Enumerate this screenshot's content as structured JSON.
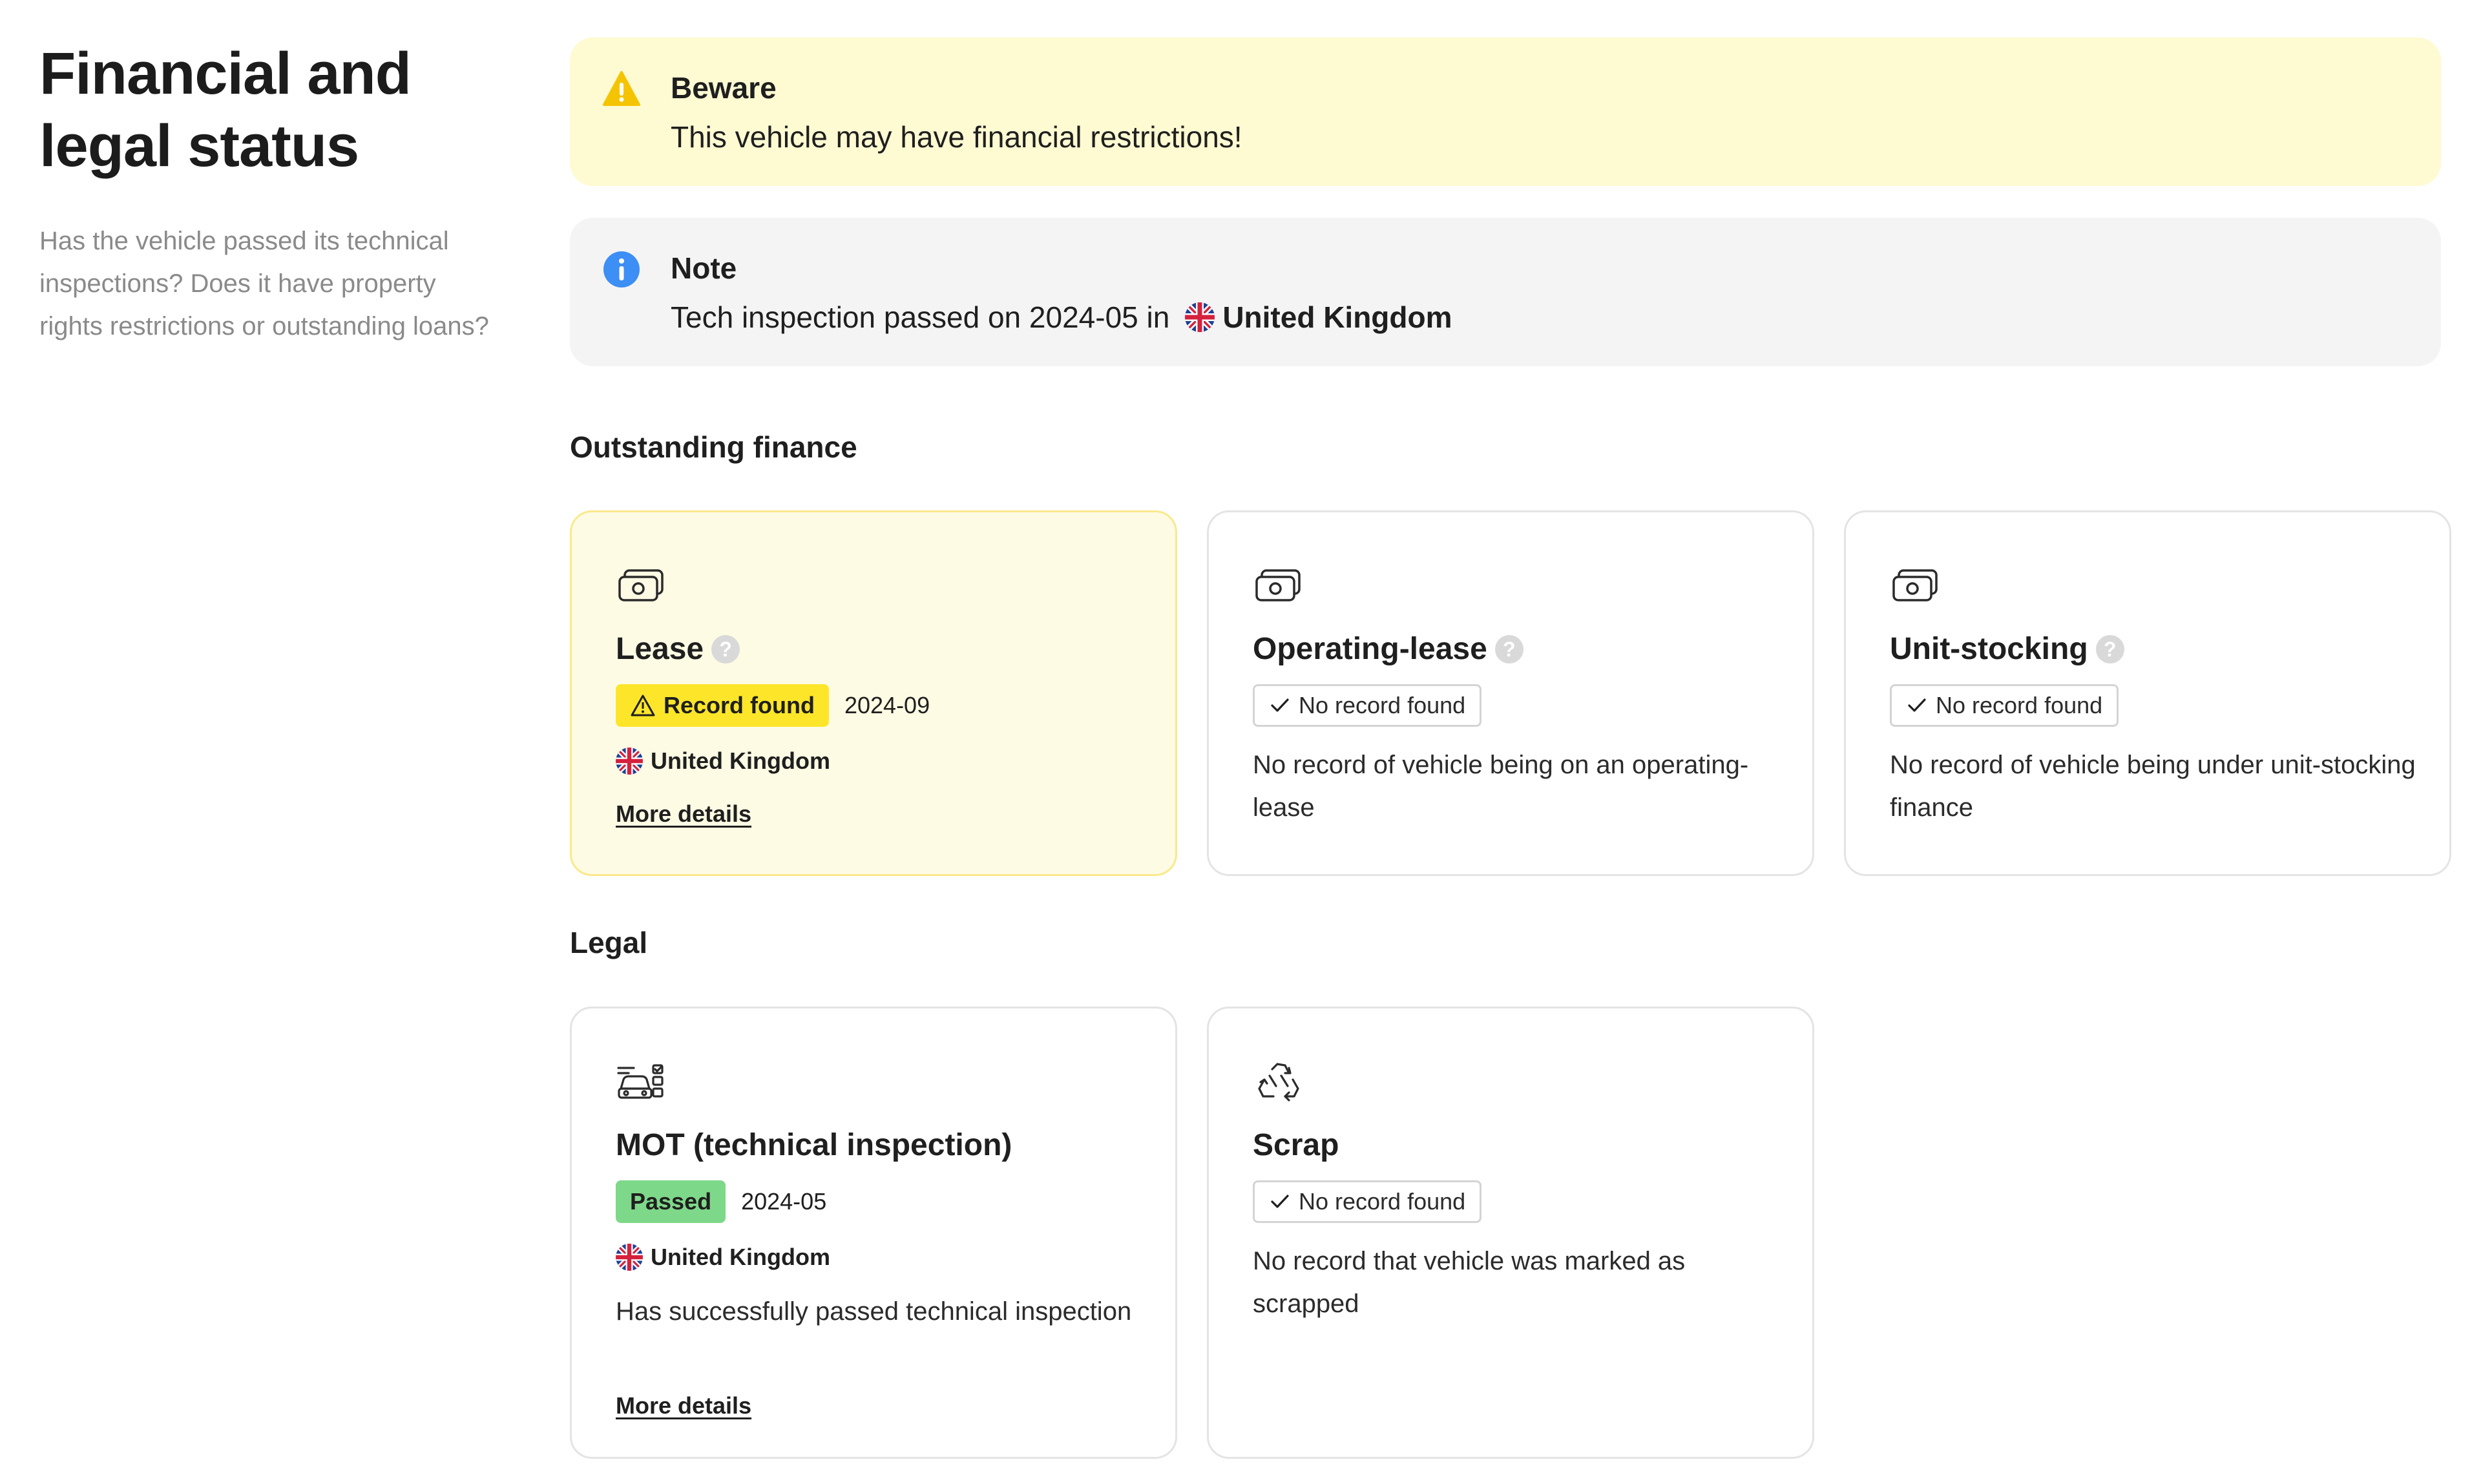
{
  "intro": {
    "title_line1": "Financial and",
    "title_line2": "legal status",
    "description": "Has the vehicle passed its technical inspections? Does it have property rights restrictions or outstanding loans?"
  },
  "alerts": {
    "beware": {
      "title": "Beware",
      "body": "This vehicle may have financial restrictions!",
      "icon": "warning-icon",
      "color": "#fefad2"
    },
    "note": {
      "title": "Note",
      "body_prefix": "Tech inspection passed on 2024-05 in",
      "country": "United Kingdom",
      "icon": "info-icon",
      "color": "#f4f4f4"
    }
  },
  "outstanding_finance": {
    "heading": "Outstanding finance",
    "cards": [
      {
        "title": "Lease",
        "help": "?",
        "status": "Record found",
        "date": "2024-09",
        "country": "United Kingdom",
        "link": "More details",
        "icon": "banknotes-icon"
      },
      {
        "title": "Operating-lease",
        "help": "?",
        "status": "No record found",
        "description": "No record of vehicle being on an operating-lease",
        "icon": "banknotes-icon"
      },
      {
        "title": "Unit-stocking",
        "help": "?",
        "status": "No record found",
        "description": "No record of vehicle being under unit-stocking finance",
        "icon": "banknotes-icon"
      }
    ]
  },
  "legal": {
    "heading": "Legal",
    "cards": [
      {
        "title": "MOT (technical inspection)",
        "status": "Passed",
        "date": "2024-05",
        "country": "United Kingdom",
        "description": "Has successfully passed technical inspection",
        "link": "More details",
        "icon": "car-checklist-icon"
      },
      {
        "title": "Scrap",
        "status": "No record found",
        "description": "No record that vehicle was marked as scrapped",
        "icon": "recycle-icon"
      }
    ]
  },
  "colors": {
    "record_found": "#fde62a",
    "passed": "#7ed889",
    "warning_card": "#fefbe4",
    "info_blue": "#3d8ef5"
  }
}
